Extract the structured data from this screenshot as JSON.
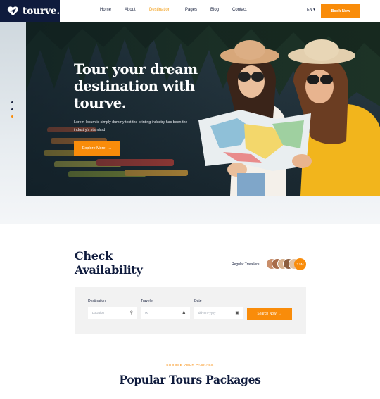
{
  "brand": {
    "name": "tourve."
  },
  "nav": {
    "items": [
      {
        "label": "Home",
        "active": false
      },
      {
        "label": "About",
        "active": false
      },
      {
        "label": "Destination",
        "active": true
      },
      {
        "label": "Pages",
        "active": false
      },
      {
        "label": "Blog",
        "active": false
      },
      {
        "label": "Contact",
        "active": false
      }
    ],
    "language": "EN",
    "book_button": "Book Now"
  },
  "hero": {
    "title": "Tour your dream destination with tourve.",
    "subtitle": "Lorem Ipsum is simply dummy text the printing industry has been the industry's standard",
    "button": "Explore More",
    "slide_count": 3,
    "active_slide": 3
  },
  "availability": {
    "title_line1": "Check",
    "title_line2": "Availability",
    "travelers_label": "Regular Travelers",
    "travelers_count": "2.5M",
    "fields": [
      {
        "label": "Destination",
        "placeholder": "Location",
        "icon": "map-pin-icon"
      },
      {
        "label": "Traveler",
        "placeholder": "00",
        "icon": "users-icon"
      },
      {
        "label": "Date",
        "placeholder": "dd-mm-yyyy",
        "icon": "calendar-icon"
      }
    ],
    "search_button": "Search Now"
  },
  "popular": {
    "kicker": "CHOOSE YOUR PACKAGE",
    "title": "Popular Tours Packages"
  },
  "colors": {
    "accent": "#f98c0a",
    "navy": "#0f1b3d"
  }
}
